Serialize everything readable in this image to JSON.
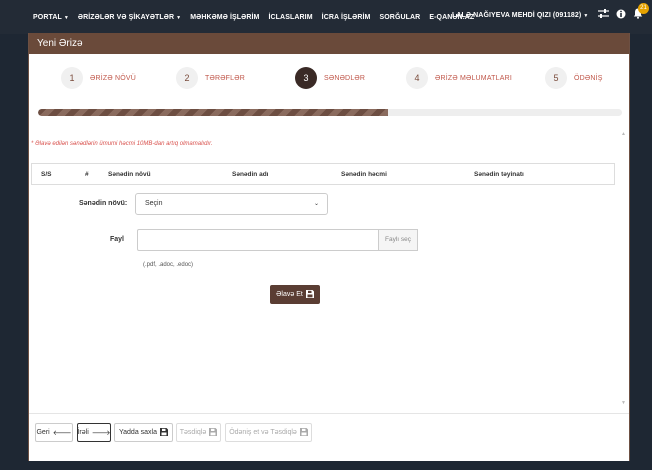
{
  "navbar": {
    "items": [
      {
        "label": "PORTAL",
        "has_caret": true
      },
      {
        "label": "ƏRİZƏLƏR VƏ ŞİKAYƏTLƏR",
        "has_caret": true
      },
      {
        "label": "MƏHKƏMƏ İŞLƏRİM",
        "has_caret": false
      },
      {
        "label": "İCLASLARIM",
        "has_caret": false
      },
      {
        "label": "İCRA İŞLƏRİM",
        "has_caret": false
      },
      {
        "label": "SORĞULAR",
        "has_caret": false
      },
      {
        "label": "E-QANUN.AZ",
        "has_caret": false
      }
    ],
    "user": "LALƏ NAĞIYEVA MEHDİ QIZI (091182)",
    "notification_count": "21",
    "icons": [
      "sliders-icon",
      "info-icon",
      "bell-icon"
    ]
  },
  "panel": {
    "title": "Yeni Ərizə"
  },
  "steps": [
    {
      "num": "1",
      "label": "ƏRİZƏ NÖVÜ",
      "active": false
    },
    {
      "num": "2",
      "label": "TƏRƏFLƏR",
      "active": false
    },
    {
      "num": "3",
      "label": "SƏNƏDLƏR",
      "active": true
    },
    {
      "num": "4",
      "label": "ƏRİZƏ MƏLUMATLARI",
      "active": false
    },
    {
      "num": "5",
      "label": "ÖDƏNİŞ",
      "active": false
    }
  ],
  "progress": {
    "fraction": 0.6
  },
  "documents": {
    "note": "* Əlavə edilən sənədlərin ümumi həcmi 10MB-dan artıq olmamalıdır.",
    "columns": [
      "S/S",
      "#",
      "Sənədin növü",
      "Sənədin adı",
      "Sənədin həcmi",
      "Sənədin təyinatı"
    ],
    "rows": [],
    "type_label": "Sənədin növü:",
    "type_value": "Seçin",
    "file_label": "Fayl",
    "file_value": "",
    "file_button": "Faylı seç",
    "file_hint": "(.pdf, .adoc, .edoc)",
    "add_button": "Əlavə Et"
  },
  "footer": {
    "back": "Geri",
    "next": "İrəli",
    "save": "Yadda saxla",
    "confirm": "Təsdiqlə",
    "pay_confirm": "Ödəniş et və Təsdiqlə"
  }
}
